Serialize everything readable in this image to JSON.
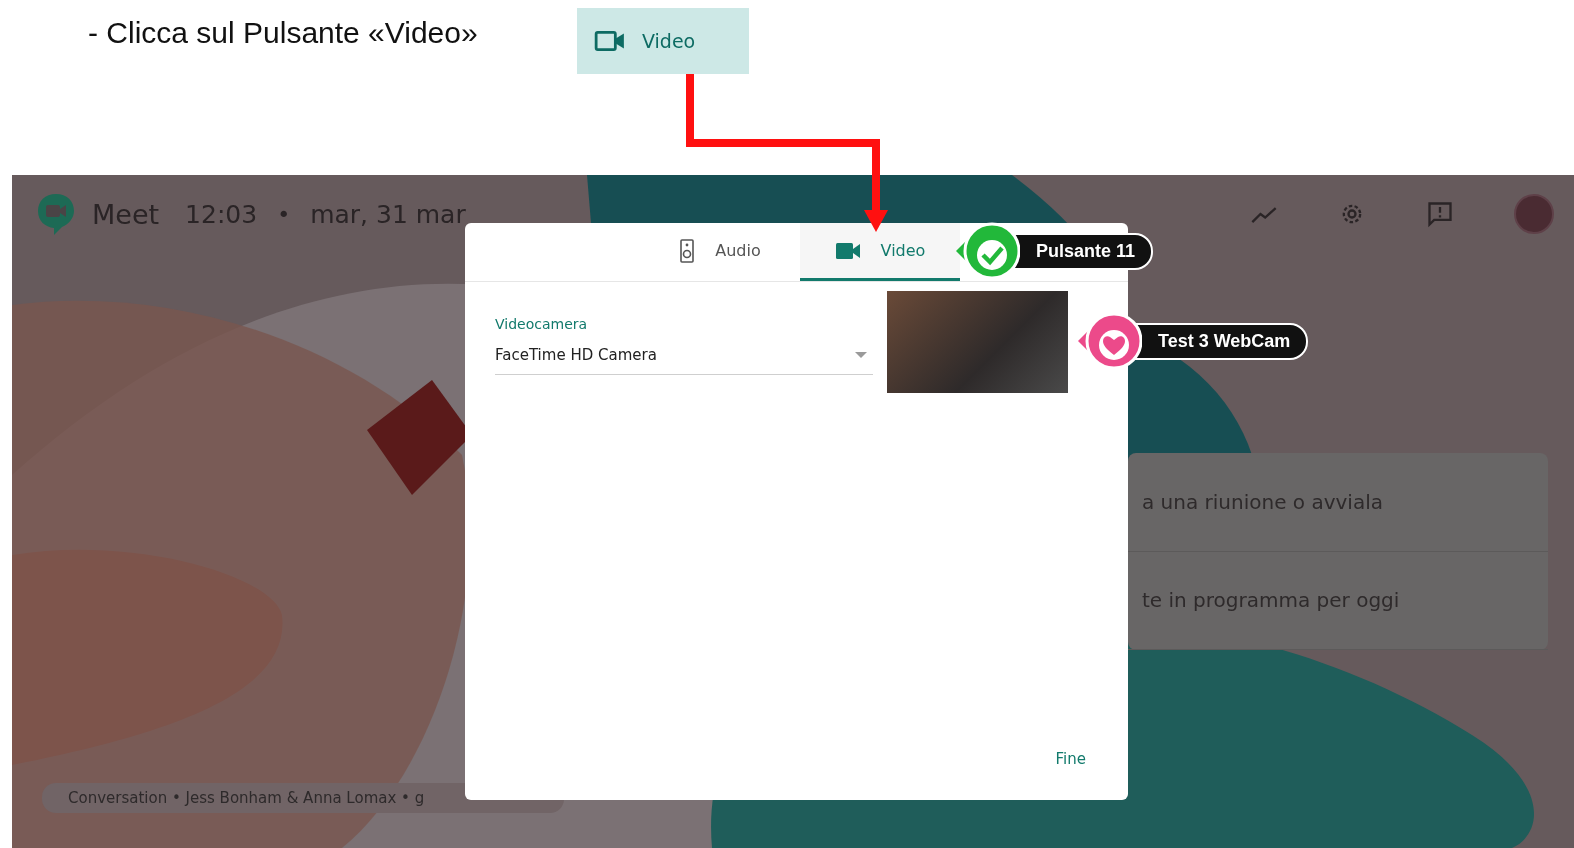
{
  "instruction": "- Clicca sul Pulsante «Video»",
  "highlight_button": {
    "label": "Video"
  },
  "meet": {
    "header": {
      "app_name": "Meet",
      "time": "12:03",
      "separator": "•",
      "date": "mar, 31 mar"
    },
    "side_card": {
      "rows": [
        "a una riunione o avviala",
        "te in programma per oggi"
      ]
    },
    "caption": "Conversation • Jess Bonham & Anna Lomax • g",
    "settings_dialog": {
      "tabs": [
        {
          "label": "Audio",
          "kind": "speaker",
          "selected": false
        },
        {
          "label": "Video",
          "kind": "camera",
          "selected": true
        }
      ],
      "field": {
        "label": "Videocamera",
        "value": "FaceTime HD Camera"
      },
      "done_button": "Fine"
    },
    "callouts": [
      {
        "label": "Pulsante 11",
        "kind": "check",
        "color": "#22b83a"
      },
      {
        "label": "Test 3 WebCam",
        "kind": "heart",
        "color": "#ec4a8a"
      }
    ]
  }
}
